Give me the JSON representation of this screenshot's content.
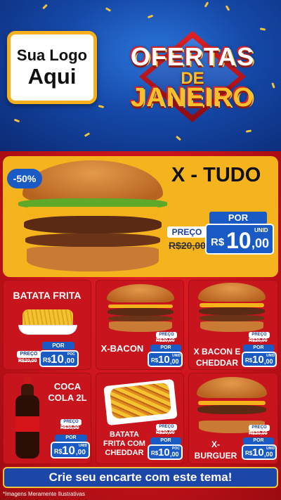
{
  "header": {
    "logo_line1": "Sua Logo",
    "logo_line2": "Aqui",
    "title_line1": "OFERTAS",
    "title_line2": "DE",
    "title_line3": "JANEIRO"
  },
  "featured": {
    "discount": "-50%",
    "name": "X - TUDO",
    "preco_label": "PREÇO",
    "old_price": "R$20,00",
    "por_label": "POR",
    "currency": "R$",
    "price_int": "10",
    "price_dec": ",00",
    "unit": "UNID"
  },
  "products": [
    {
      "name": "BATATA FRITA",
      "preco_label": "PREÇO",
      "old_price": "R$20,00",
      "por_label": "POR",
      "currency": "R$",
      "price_int": "10",
      "price_dec": ",00",
      "unit": "POC"
    },
    {
      "name": "X-BACON",
      "preco_label": "PREÇO",
      "old_price": "R$20,00",
      "por_label": "POR",
      "currency": "R$",
      "price_int": "10",
      "price_dec": ",00",
      "unit": "UNID"
    },
    {
      "name": "X BACON E CHEDDAR",
      "preco_label": "PREÇO",
      "old_price": "R$20,00",
      "por_label": "POR",
      "currency": "R$",
      "price_int": "10",
      "price_dec": ",00",
      "unit": "UNID"
    },
    {
      "name": "COCA COLA 2L",
      "preco_label": "PREÇO",
      "old_price": "R$20,00",
      "por_label": "POR",
      "currency": "R$",
      "price_int": "10",
      "price_dec": ",00",
      "unit": "UNID"
    },
    {
      "name": "BATATA FRITA COM CHEDDAR",
      "preco_label": "PREÇO",
      "old_price": "R$20,00",
      "por_label": "POR",
      "currency": "R$",
      "price_int": "10",
      "price_dec": ",00",
      "unit": "POC"
    },
    {
      "name": "X-BURGUER",
      "preco_label": "PREÇO",
      "old_price": "R$20,00",
      "por_label": "POR",
      "currency": "R$",
      "price_int": "10",
      "price_dec": ",00",
      "unit": "UNID"
    }
  ],
  "cta": "Crie seu encarte com este tema!",
  "disclaimer": "*Imagens Meramente Ilustrativas",
  "colors": {
    "brand_blue": "#1a5ac4",
    "brand_red": "#c8151d",
    "brand_yellow": "#f5b31e"
  }
}
